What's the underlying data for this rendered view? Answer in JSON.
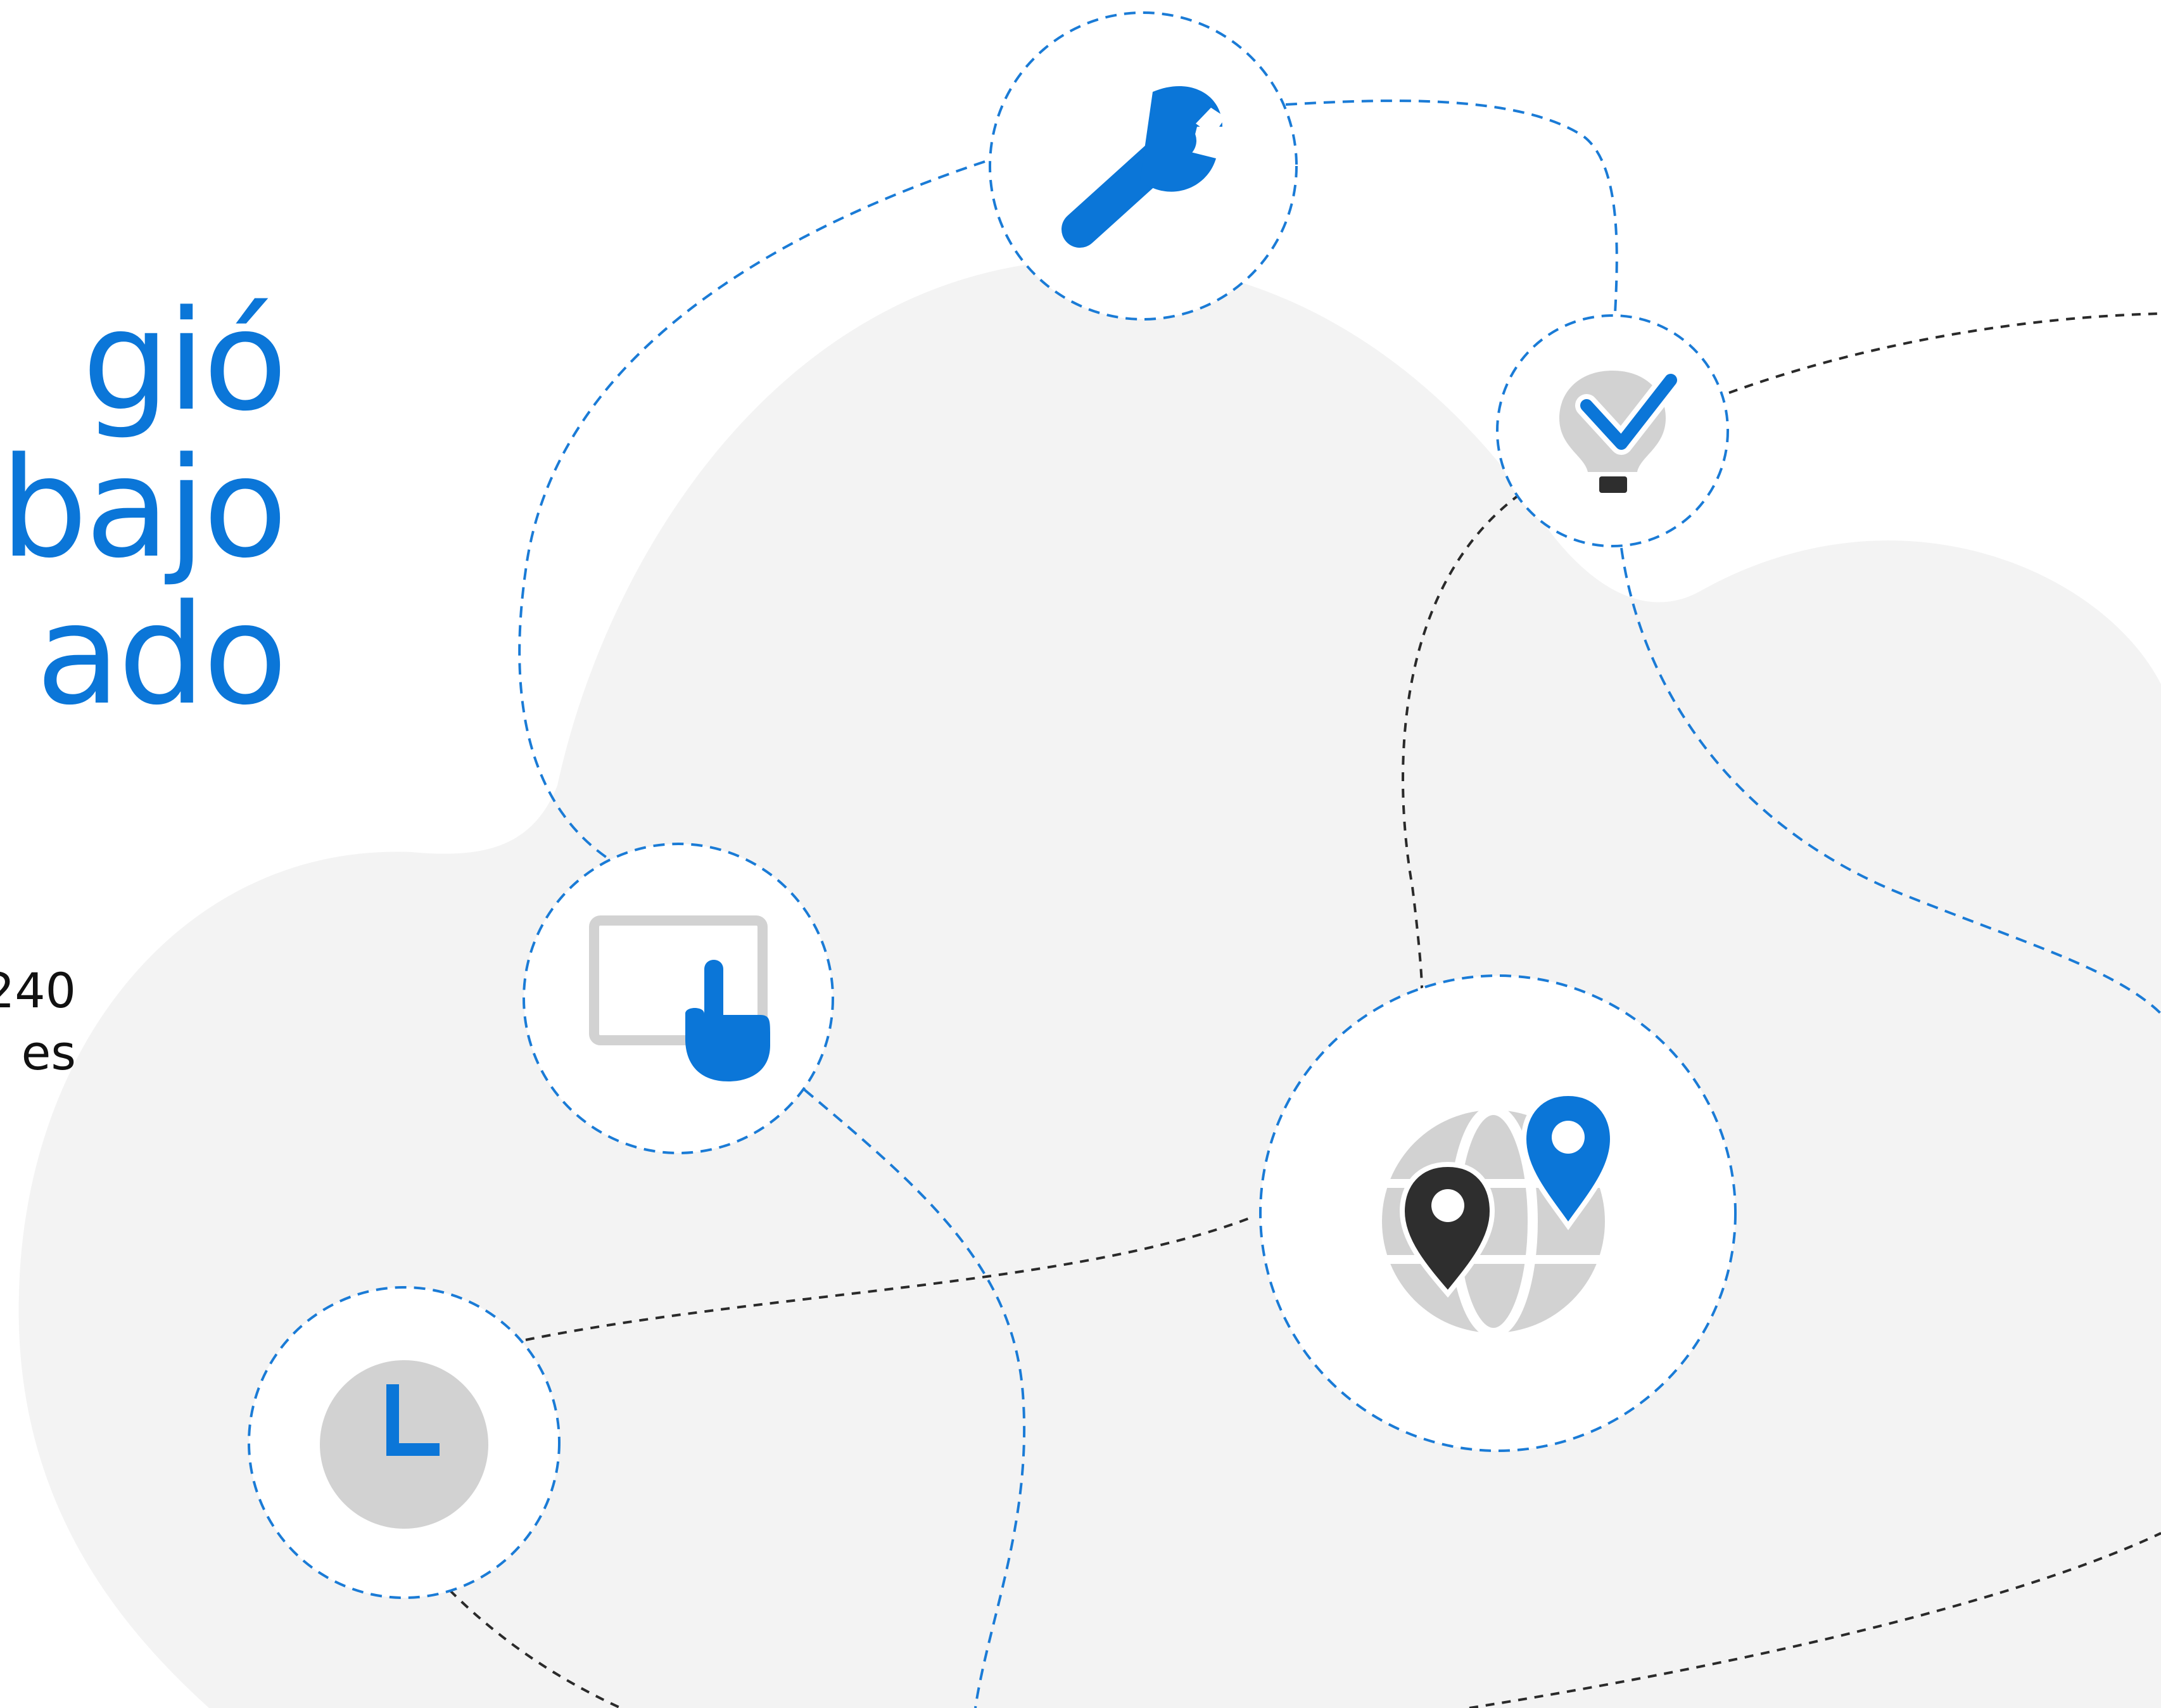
{
  "headline": {
    "line1": "gió",
    "line2": "bajo",
    "line3": "ado"
  },
  "subtext": {
    "line1": "240",
    "line2": "es"
  },
  "colors": {
    "accent_blue": "#0b76d8",
    "cloud_gray": "#f3f3f3",
    "icon_gray": "#d2d2d2",
    "dark": "#2e2e2e",
    "dashed_blue": "#1a7bd6",
    "dashed_dark": "#2a2a2a"
  },
  "nodes": [
    {
      "icon": "wrench-icon"
    },
    {
      "icon": "lightbulb-check-icon"
    },
    {
      "icon": "tablet-touch-icon"
    },
    {
      "icon": "globe-location-icon"
    },
    {
      "icon": "clock-icon"
    }
  ]
}
